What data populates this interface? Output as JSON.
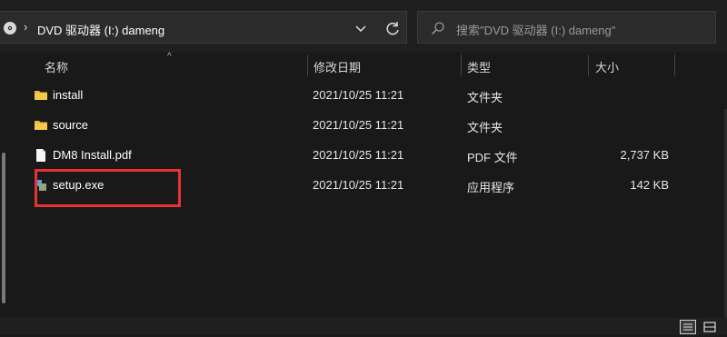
{
  "address": {
    "path": "DVD 驱动器 (I:) dameng"
  },
  "search": {
    "placeholder": "搜索\"DVD 驱动器 (I:) dameng\""
  },
  "columns": {
    "name": "名称",
    "date": "修改日期",
    "type": "类型",
    "size": "大小"
  },
  "files": [
    {
      "name": "install",
      "date": "2021/10/25 11:21",
      "type": "文件夹",
      "size": "",
      "icon": "folder-icon"
    },
    {
      "name": "source",
      "date": "2021/10/25 11:21",
      "type": "文件夹",
      "size": "",
      "icon": "folder-icon"
    },
    {
      "name": "DM8 Install.pdf",
      "date": "2021/10/25 11:21",
      "type": "PDF 文件",
      "size": "2,737 KB",
      "icon": "pdf-file-icon"
    },
    {
      "name": "setup.exe",
      "date": "2021/10/25 11:21",
      "type": "应用程序",
      "size": "142 KB",
      "icon": "exe-file-icon"
    }
  ],
  "colors": {
    "background": "#191919",
    "folder": "#e8b83a",
    "highlight": "#e53333"
  }
}
